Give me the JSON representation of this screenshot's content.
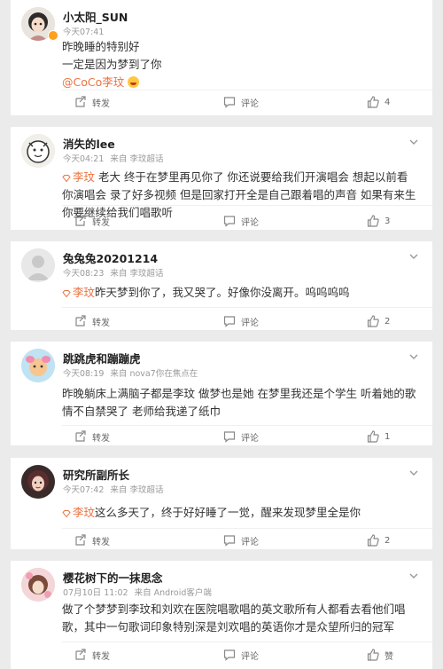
{
  "comments": [
    {
      "user": "小太阳_SUN",
      "time": "今天07:41",
      "source": "",
      "lines": [
        "昨晚睡的特别好",
        "一定是因为梦到了你"
      ],
      "mention": "@CoCo李玟",
      "actions": {
        "repost": "转发",
        "comment": "评论",
        "like": "4"
      }
    },
    {
      "user": "消失的lee",
      "time": "今天04:21",
      "source": "来自 李玟超话",
      "tag": "李玟",
      "text": " 老大 终于在梦里再见你了 你还说要给我们开演唱会 想起以前看你演唱会 录了好多视频 但是回家打开全是自己跟着唱的声音 如果有来生 你要继续给我们唱歌听",
      "actions": {
        "repost": "转发",
        "comment": "评论",
        "like": "3"
      }
    },
    {
      "user": "兔兔兔20201214",
      "time": "今天08:23",
      "source": "来自 李玟超话",
      "tag": "李玟",
      "text": "昨天梦到你了，我又哭了。好像你没离开。呜呜呜呜",
      "actions": {
        "repost": "转发",
        "comment": "评论",
        "like": "2"
      }
    },
    {
      "user": "跳跳虎和蹦蹦虎",
      "time": "今天08:19",
      "source": "来自 nova7你在焦点在",
      "text": "昨晚躺床上满脑子都是李玟 做梦也是她 在梦里我还是个学生 听着她的歌 情不自禁哭了 老师给我递了纸巾",
      "actions": {
        "repost": "转发",
        "comment": "评论",
        "like": "1"
      }
    },
    {
      "user": "研究所副所长",
      "time": "今天07:42",
      "source": "来自 李玟超话",
      "tag": "李玟",
      "text": "这么多天了，终于好好睡了一觉，醒来发现梦里全是你",
      "actions": {
        "repost": "转发",
        "comment": "评论",
        "like": "2"
      }
    },
    {
      "user": "樱花树下的一抹思念",
      "time": "07月10日 11:02",
      "source": "来自 Android客户端",
      "text": "做了个梦梦到李玟和刘欢在医院唱歌唱的英文歌所有人都看去看他们唱歌，其中一句歌词印象特别深是刘欢唱的英语你才是众望所归的冠军",
      "actions": {
        "repost": "转发",
        "comment": "评论",
        "like": "赞"
      }
    }
  ],
  "colors": {
    "accent": "#eb7340",
    "background": "#ebebeb",
    "verified": "#ff9f1a"
  }
}
